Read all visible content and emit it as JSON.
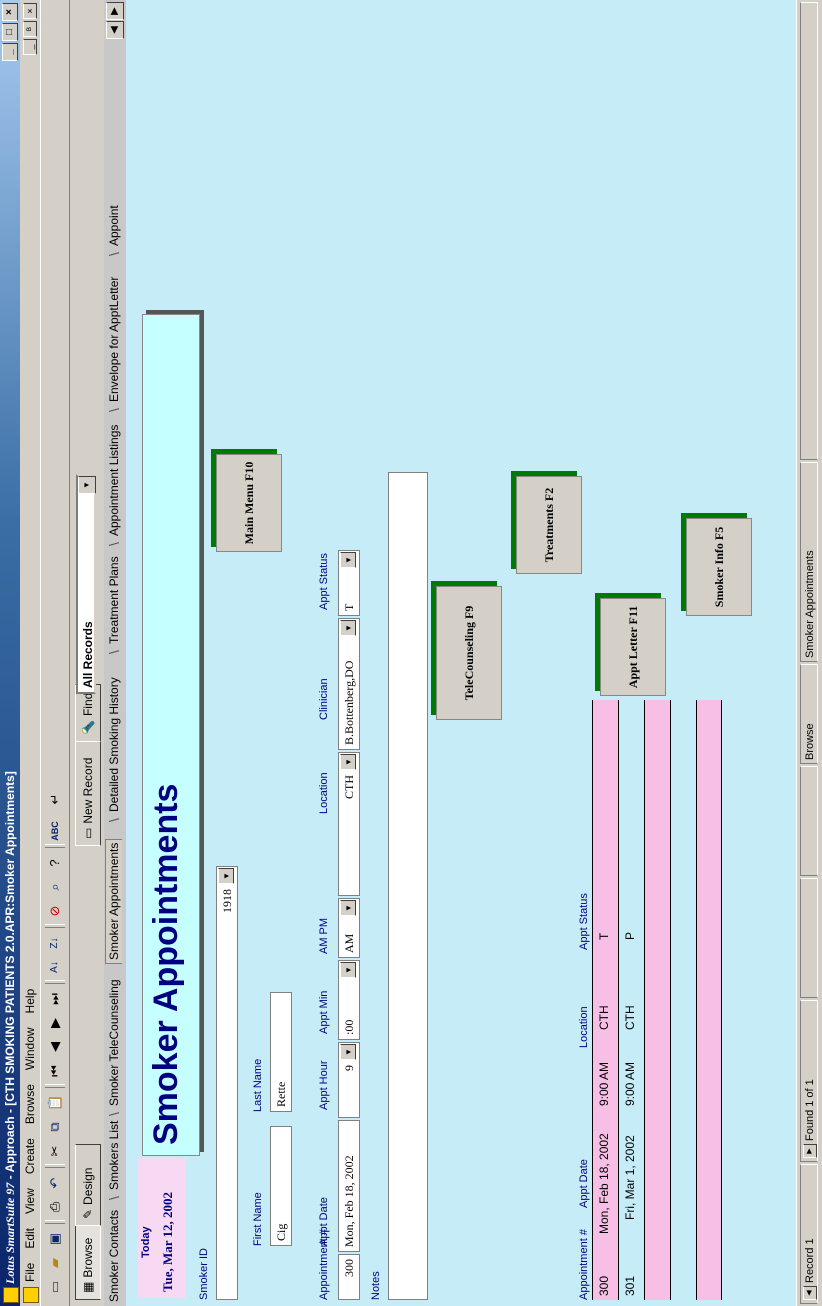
{
  "window": {
    "app_name": "Lotus SmartSuite 97",
    "title": "- Approach - [CTH SMOKING PATIENTS 2.0.APR:Smoker Appointments]",
    "controls": [
      "_",
      "□",
      "×"
    ]
  },
  "menu": {
    "items": [
      "File",
      "Edit",
      "View",
      "Create",
      "Browse",
      "Window",
      "Help"
    ],
    "doc_controls": [
      "_",
      "ᴮ",
      "×"
    ]
  },
  "toolbar": {
    "icons": [
      "new-icon",
      "open-icon",
      "save-icon",
      "print-icon",
      "undo-icon",
      "cut-icon",
      "copy-icon",
      "paste-icon",
      "first-record-icon",
      "previous-record-icon",
      "next-record-icon",
      "last-record-icon",
      "sort-ascending-icon",
      "sort-descending-icon",
      "delete-record-icon",
      "find-icon",
      "help-icon",
      "spell-check-icon",
      "enter-icon"
    ]
  },
  "actionbar": {
    "browse_label": "Browse",
    "design_label": "Design",
    "new_record_label": "New Record",
    "find_label": "Find",
    "record_selector": "All Records"
  },
  "tabs": [
    "Smoker Contacts",
    "Smokers List",
    "Smoker TeleCounseling",
    "Smoker Appointments",
    "Detailed Smoking History",
    "Treatment Plans",
    "Appointment Listings",
    "Envelope for ApptLetter",
    "Appoint"
  ],
  "form": {
    "today_label": "Today",
    "today_value": "Tue, Mar 12, 2002",
    "heading": "Smoker Appointments",
    "smoker_id_label": "Smoker ID",
    "smoker_id_value": "1918",
    "first_name_label": "First Name",
    "first_name_value": "Cig",
    "last_name_label": "Last Name",
    "last_name_value": "Rette",
    "appt_num_label": "Appointment #",
    "appt_num_value": "300",
    "appt_date_label": "Appt Date",
    "appt_date_value": "Mon, Feb 18, 2002",
    "appt_hour_label": "Appt Hour",
    "appt_hour_value": "9",
    "appt_min_label": "Appt Min",
    "appt_min_value": ":00",
    "ampm_label": "AM PM",
    "ampm_value": "AM",
    "location_label": "Location",
    "location_value": "CTH",
    "clinician_label": "Clinician",
    "clinician_value": "B.Bottenberg,DO",
    "appt_status_label": "Appt Status",
    "appt_status_value": "T",
    "notes_label": "Notes",
    "notes_value": ""
  },
  "buttons": {
    "main_menu": "Main Menu F10",
    "telecounseling": "TeleCounseling F9",
    "treatments": "Treatments F2",
    "appt_letter": "Appt Letter F11",
    "smoker_info": "Smoker Info F5"
  },
  "grid": {
    "headers": [
      "Appointment #",
      "Appt Date",
      "Location",
      "Appt Status"
    ],
    "rows": [
      [
        "300",
        "Mon, Feb 18, 2002",
        "9:00 AM",
        "CTH",
        "T"
      ],
      [
        "301",
        "Fri, Mar 1, 2002",
        "9:00 AM",
        "CTH",
        "P"
      ]
    ]
  },
  "status": {
    "record": "Record 1",
    "found": "Found 1 of 1",
    "mode": "Browse",
    "view": "Smoker Appointments"
  },
  "colors": {
    "form_background": "#c6ecf7",
    "pink_row": "#f7bfe6",
    "heading_text": "#000080",
    "button_shadow": "#007a00"
  }
}
